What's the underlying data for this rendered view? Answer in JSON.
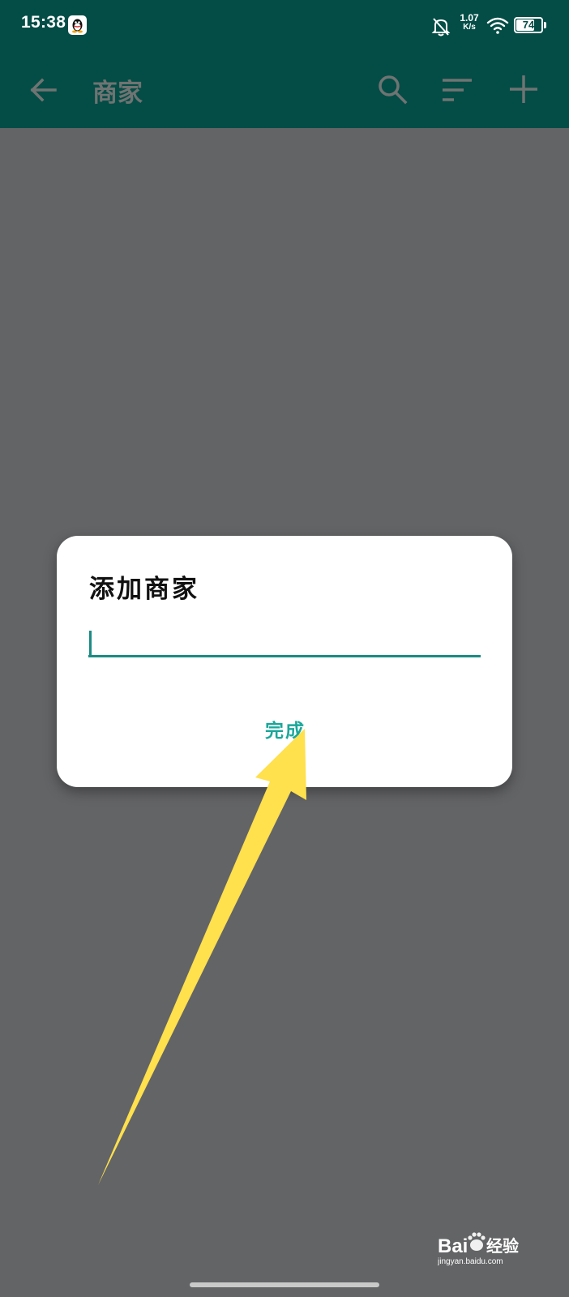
{
  "status_bar": {
    "time": "15:38",
    "net_speed_value": "1.07",
    "net_speed_unit": "K/s",
    "battery_level": "74",
    "battery_fraction": 0.74
  },
  "toolbar": {
    "title": "商家",
    "background_color": "#044d47"
  },
  "dialog": {
    "title": "添加商家",
    "input_value": "",
    "done_label": "完成",
    "accent_color": "#1a8c83"
  },
  "watermark": {
    "brand": "Bai",
    "brand_suffix": "经验",
    "url": "jingyan.baidu.com"
  },
  "icons": [
    "qq-icon",
    "bell-off-icon",
    "wifi-icon",
    "battery-icon",
    "back-arrow-icon",
    "search-icon",
    "sort-icon",
    "add-icon",
    "baidu-paw-icon"
  ],
  "annotation_color": "#ffe04d"
}
